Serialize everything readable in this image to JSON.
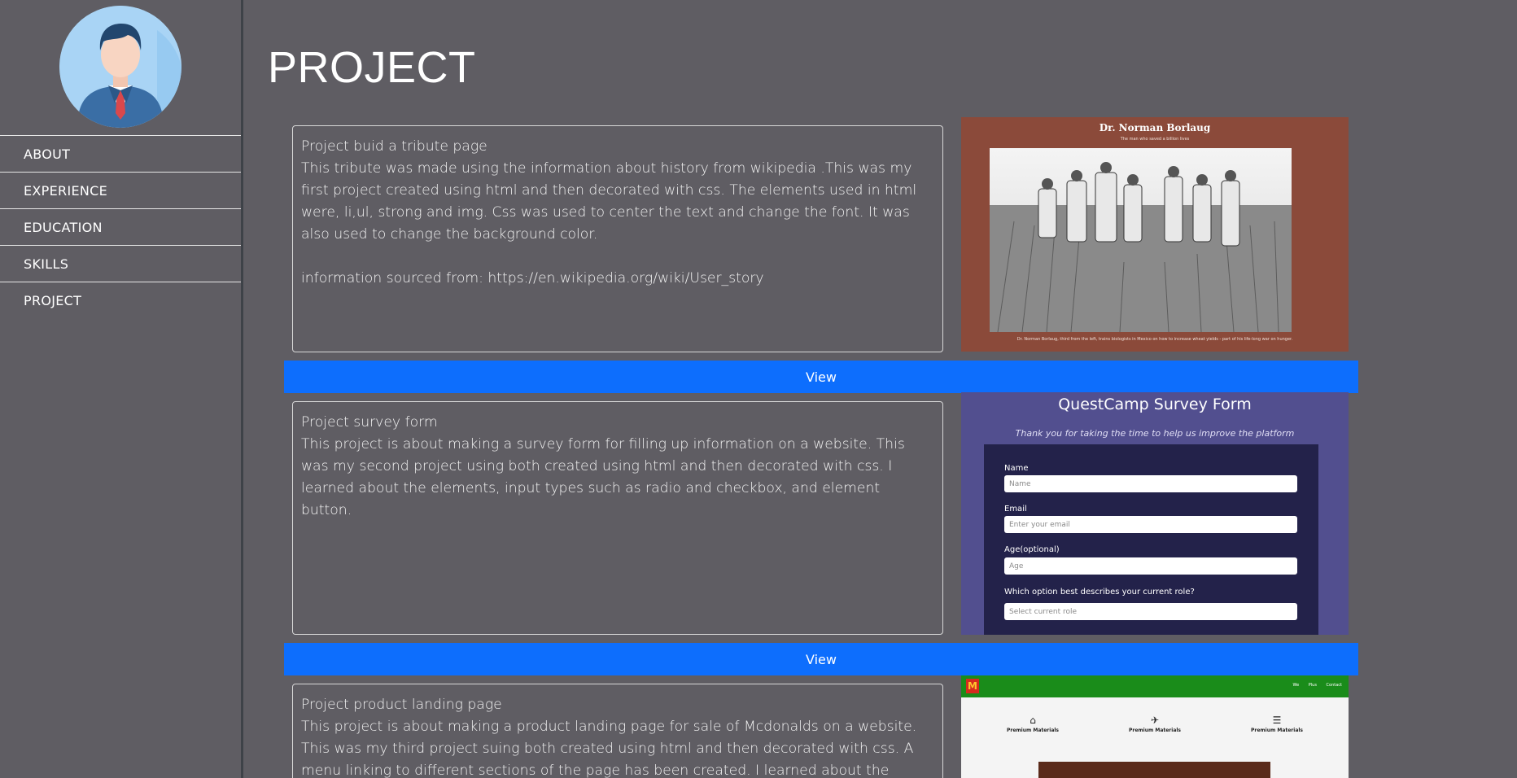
{
  "sidebar": {
    "items": [
      {
        "label": "ABOUT"
      },
      {
        "label": "EXPERIENCE"
      },
      {
        "label": "EDUCATION"
      },
      {
        "label": "SKILLS"
      },
      {
        "label": "PROJECT"
      }
    ]
  },
  "page": {
    "title": "PROJECT"
  },
  "projects": [
    {
      "title": "Project buid a tribute page",
      "body": "This tribute was made using the information about history from wikipedia .This was my first project created using html and then decorated with css. The elements used in html were, li,ul, strong and img. Css was used to center the text and change the font. It was also used to change the background color.",
      "source": "information sourced from: https://en.wikipedia.org/wiki/User_story",
      "view_label": "View",
      "preview": {
        "heading": "Dr. Norman Borlaug",
        "subheading": "The man who saved a billion lives",
        "caption": "Dr. Norman Borlaug, third from the left, trains biologists in Mexico on how to increase wheat yields - part of his life-long war on hunger."
      }
    },
    {
      "title": "Project survey form",
      "body": "This project is about making a survey form for filling up information on a website. This was my second project using both created using html and then decorated with css. I learned about the elements, input types such as radio and checkbox, and element button.",
      "view_label": "View",
      "preview": {
        "heading": "QuestCamp Survey Form",
        "subheading": "Thank you for taking the time to help us improve the platform",
        "fields": [
          {
            "label": "Name",
            "placeholder": "Name"
          },
          {
            "label": "Email",
            "placeholder": "Enter your email"
          },
          {
            "label": "Age(optional)",
            "placeholder": "Age"
          },
          {
            "label": "Which option best describes your current role?",
            "placeholder": "Select current role"
          }
        ]
      }
    },
    {
      "title": "Project product landing page",
      "body": "This project is about making a product landing page for sale of Mcdonalds on a website. This was my third project suing both created using html and then decorated with css. A menu linking to different sections of the page has been created. I learned about the element iframes for use",
      "preview": {
        "logo": "M",
        "nav": [
          "We",
          "Plus",
          "Contact"
        ],
        "features": [
          "Premium Materials",
          "Premium Materials",
          "Premium Materials"
        ]
      }
    }
  ],
  "colors": {
    "background": "#5f5d63",
    "button": "#0d6efd",
    "sidebar_border": "#3e4248"
  }
}
